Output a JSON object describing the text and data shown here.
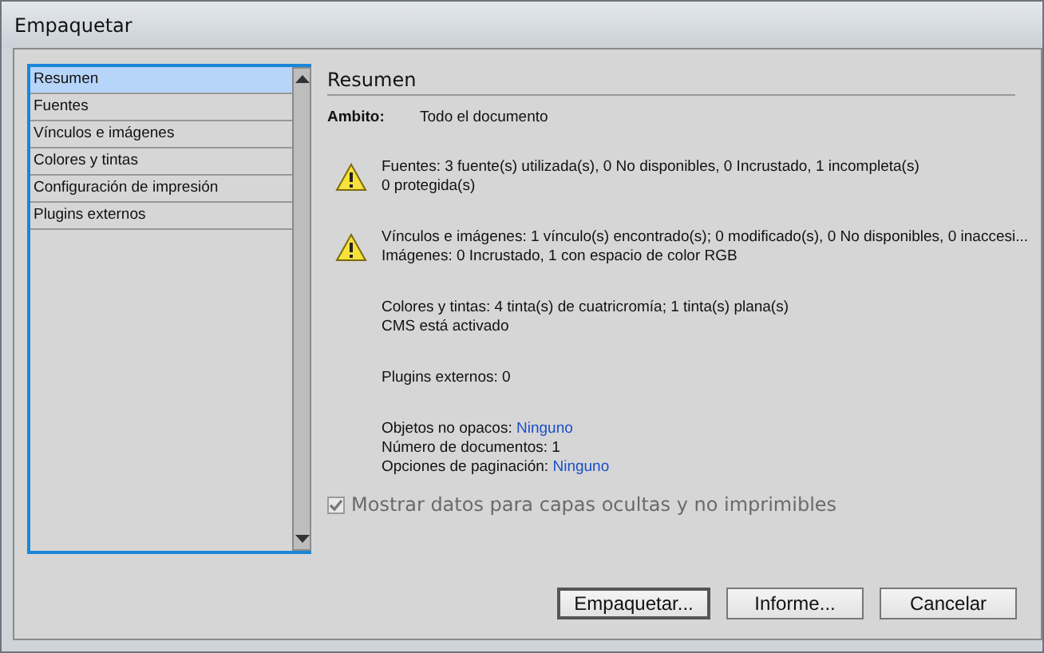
{
  "window": {
    "title": "Empaquetar"
  },
  "sidebar": {
    "items": [
      {
        "label": "Resumen",
        "selected": true
      },
      {
        "label": "Fuentes",
        "selected": false
      },
      {
        "label": "Vínculos e imágenes",
        "selected": false
      },
      {
        "label": "Colores y tintas",
        "selected": false
      },
      {
        "label": "Configuración de impresión",
        "selected": false
      },
      {
        "label": "Plugins externos",
        "selected": false
      }
    ]
  },
  "panel": {
    "heading": "Resumen",
    "scope_label": "Ambito:",
    "scope_value": "Todo el documento",
    "sections": [
      {
        "kind": "warning",
        "lines": [
          {
            "text": "Fuentes: 3 fuente(s) utilizada(s), 0 No disponibles, 0 Incrustado, 1 incompleta(s)"
          },
          {
            "text": "0 protegida(s)"
          }
        ]
      },
      {
        "kind": "warning",
        "lines": [
          {
            "text": "Vínculos e imágenes: 1 vínculo(s) encontrado(s); 0 modificado(s), 0 No disponibles, 0 inaccesi..."
          },
          {
            "text": "Imágenes: 0 Incrustado, 1 con espacio de color RGB"
          }
        ]
      },
      {
        "kind": "info",
        "lines": [
          {
            "text": "Colores y tintas: 4 tinta(s) de cuatricromía; 1 tinta(s) plana(s)"
          },
          {
            "text": "CMS está activado"
          }
        ]
      },
      {
        "kind": "info",
        "lines": [
          {
            "text": "Plugins externos: 0"
          }
        ]
      },
      {
        "kind": "info",
        "lines": [
          {
            "text": "Objetos no opacos: ",
            "link": "Ninguno"
          },
          {
            "text": "Número de documentos: 1"
          },
          {
            "text": "Opciones de paginación: ",
            "link": "Ninguno"
          }
        ]
      }
    ],
    "checkbox": {
      "label": "Mostrar datos para capas ocultas y no imprimibles",
      "checked": true
    }
  },
  "buttons": [
    {
      "label": "Empaquetar...",
      "default": true
    },
    {
      "label": "Informe...",
      "default": false
    },
    {
      "label": "Cancelar",
      "default": false
    }
  ]
}
